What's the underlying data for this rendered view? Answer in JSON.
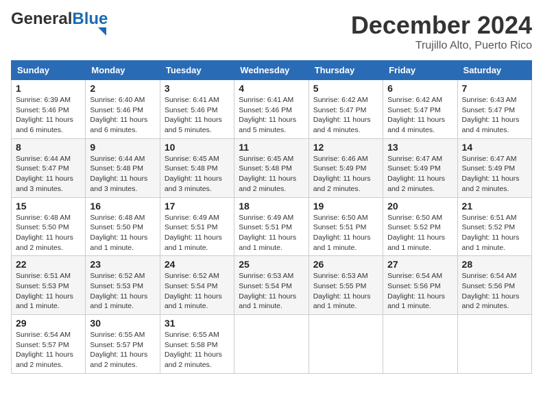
{
  "header": {
    "logo_general": "General",
    "logo_blue": "Blue",
    "month": "December 2024",
    "location": "Trujillo Alto, Puerto Rico"
  },
  "weekdays": [
    "Sunday",
    "Monday",
    "Tuesday",
    "Wednesday",
    "Thursday",
    "Friday",
    "Saturday"
  ],
  "weeks": [
    [
      {
        "day": "1",
        "sunrise": "6:39 AM",
        "sunset": "5:46 PM",
        "daylight": "11 hours and 6 minutes."
      },
      {
        "day": "2",
        "sunrise": "6:40 AM",
        "sunset": "5:46 PM",
        "daylight": "11 hours and 6 minutes."
      },
      {
        "day": "3",
        "sunrise": "6:41 AM",
        "sunset": "5:46 PM",
        "daylight": "11 hours and 5 minutes."
      },
      {
        "day": "4",
        "sunrise": "6:41 AM",
        "sunset": "5:46 PM",
        "daylight": "11 hours and 5 minutes."
      },
      {
        "day": "5",
        "sunrise": "6:42 AM",
        "sunset": "5:47 PM",
        "daylight": "11 hours and 4 minutes."
      },
      {
        "day": "6",
        "sunrise": "6:42 AM",
        "sunset": "5:47 PM",
        "daylight": "11 hours and 4 minutes."
      },
      {
        "day": "7",
        "sunrise": "6:43 AM",
        "sunset": "5:47 PM",
        "daylight": "11 hours and 4 minutes."
      }
    ],
    [
      {
        "day": "8",
        "sunrise": "6:44 AM",
        "sunset": "5:47 PM",
        "daylight": "11 hours and 3 minutes."
      },
      {
        "day": "9",
        "sunrise": "6:44 AM",
        "sunset": "5:48 PM",
        "daylight": "11 hours and 3 minutes."
      },
      {
        "day": "10",
        "sunrise": "6:45 AM",
        "sunset": "5:48 PM",
        "daylight": "11 hours and 3 minutes."
      },
      {
        "day": "11",
        "sunrise": "6:45 AM",
        "sunset": "5:48 PM",
        "daylight": "11 hours and 2 minutes."
      },
      {
        "day": "12",
        "sunrise": "6:46 AM",
        "sunset": "5:49 PM",
        "daylight": "11 hours and 2 minutes."
      },
      {
        "day": "13",
        "sunrise": "6:47 AM",
        "sunset": "5:49 PM",
        "daylight": "11 hours and 2 minutes."
      },
      {
        "day": "14",
        "sunrise": "6:47 AM",
        "sunset": "5:49 PM",
        "daylight": "11 hours and 2 minutes."
      }
    ],
    [
      {
        "day": "15",
        "sunrise": "6:48 AM",
        "sunset": "5:50 PM",
        "daylight": "11 hours and 2 minutes."
      },
      {
        "day": "16",
        "sunrise": "6:48 AM",
        "sunset": "5:50 PM",
        "daylight": "11 hours and 1 minute."
      },
      {
        "day": "17",
        "sunrise": "6:49 AM",
        "sunset": "5:51 PM",
        "daylight": "11 hours and 1 minute."
      },
      {
        "day": "18",
        "sunrise": "6:49 AM",
        "sunset": "5:51 PM",
        "daylight": "11 hours and 1 minute."
      },
      {
        "day": "19",
        "sunrise": "6:50 AM",
        "sunset": "5:51 PM",
        "daylight": "11 hours and 1 minute."
      },
      {
        "day": "20",
        "sunrise": "6:50 AM",
        "sunset": "5:52 PM",
        "daylight": "11 hours and 1 minute."
      },
      {
        "day": "21",
        "sunrise": "6:51 AM",
        "sunset": "5:52 PM",
        "daylight": "11 hours and 1 minute."
      }
    ],
    [
      {
        "day": "22",
        "sunrise": "6:51 AM",
        "sunset": "5:53 PM",
        "daylight": "11 hours and 1 minute."
      },
      {
        "day": "23",
        "sunrise": "6:52 AM",
        "sunset": "5:53 PM",
        "daylight": "11 hours and 1 minute."
      },
      {
        "day": "24",
        "sunrise": "6:52 AM",
        "sunset": "5:54 PM",
        "daylight": "11 hours and 1 minute."
      },
      {
        "day": "25",
        "sunrise": "6:53 AM",
        "sunset": "5:54 PM",
        "daylight": "11 hours and 1 minute."
      },
      {
        "day": "26",
        "sunrise": "6:53 AM",
        "sunset": "5:55 PM",
        "daylight": "11 hours and 1 minute."
      },
      {
        "day": "27",
        "sunrise": "6:54 AM",
        "sunset": "5:56 PM",
        "daylight": "11 hours and 1 minute."
      },
      {
        "day": "28",
        "sunrise": "6:54 AM",
        "sunset": "5:56 PM",
        "daylight": "11 hours and 2 minutes."
      }
    ],
    [
      {
        "day": "29",
        "sunrise": "6:54 AM",
        "sunset": "5:57 PM",
        "daylight": "11 hours and 2 minutes."
      },
      {
        "day": "30",
        "sunrise": "6:55 AM",
        "sunset": "5:57 PM",
        "daylight": "11 hours and 2 minutes."
      },
      {
        "day": "31",
        "sunrise": "6:55 AM",
        "sunset": "5:58 PM",
        "daylight": "11 hours and 2 minutes."
      },
      null,
      null,
      null,
      null
    ]
  ]
}
